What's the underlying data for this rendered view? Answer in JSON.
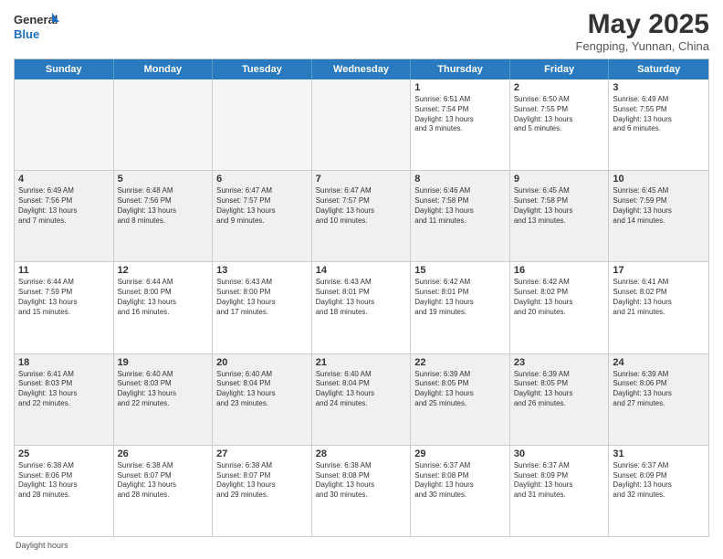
{
  "header": {
    "logo_general": "General",
    "logo_blue": "Blue",
    "title": "May 2025",
    "subtitle": "Fengping, Yunnan, China"
  },
  "calendar": {
    "days_of_week": [
      "Sunday",
      "Monday",
      "Tuesday",
      "Wednesday",
      "Thursday",
      "Friday",
      "Saturday"
    ],
    "weeks": [
      [
        {
          "day": "",
          "info": "",
          "empty": true
        },
        {
          "day": "",
          "info": "",
          "empty": true
        },
        {
          "day": "",
          "info": "",
          "empty": true
        },
        {
          "day": "",
          "info": "",
          "empty": true
        },
        {
          "day": "1",
          "info": "Sunrise: 6:51 AM\nSunset: 7:54 PM\nDaylight: 13 hours\nand 3 minutes."
        },
        {
          "day": "2",
          "info": "Sunrise: 6:50 AM\nSunset: 7:55 PM\nDaylight: 13 hours\nand 5 minutes."
        },
        {
          "day": "3",
          "info": "Sunrise: 6:49 AM\nSunset: 7:55 PM\nDaylight: 13 hours\nand 6 minutes."
        }
      ],
      [
        {
          "day": "4",
          "info": "Sunrise: 6:49 AM\nSunset: 7:56 PM\nDaylight: 13 hours\nand 7 minutes."
        },
        {
          "day": "5",
          "info": "Sunrise: 6:48 AM\nSunset: 7:56 PM\nDaylight: 13 hours\nand 8 minutes."
        },
        {
          "day": "6",
          "info": "Sunrise: 6:47 AM\nSunset: 7:57 PM\nDaylight: 13 hours\nand 9 minutes."
        },
        {
          "day": "7",
          "info": "Sunrise: 6:47 AM\nSunset: 7:57 PM\nDaylight: 13 hours\nand 10 minutes."
        },
        {
          "day": "8",
          "info": "Sunrise: 6:46 AM\nSunset: 7:58 PM\nDaylight: 13 hours\nand 11 minutes."
        },
        {
          "day": "9",
          "info": "Sunrise: 6:45 AM\nSunset: 7:58 PM\nDaylight: 13 hours\nand 13 minutes."
        },
        {
          "day": "10",
          "info": "Sunrise: 6:45 AM\nSunset: 7:59 PM\nDaylight: 13 hours\nand 14 minutes."
        }
      ],
      [
        {
          "day": "11",
          "info": "Sunrise: 6:44 AM\nSunset: 7:59 PM\nDaylight: 13 hours\nand 15 minutes."
        },
        {
          "day": "12",
          "info": "Sunrise: 6:44 AM\nSunset: 8:00 PM\nDaylight: 13 hours\nand 16 minutes."
        },
        {
          "day": "13",
          "info": "Sunrise: 6:43 AM\nSunset: 8:00 PM\nDaylight: 13 hours\nand 17 minutes."
        },
        {
          "day": "14",
          "info": "Sunrise: 6:43 AM\nSunset: 8:01 PM\nDaylight: 13 hours\nand 18 minutes."
        },
        {
          "day": "15",
          "info": "Sunrise: 6:42 AM\nSunset: 8:01 PM\nDaylight: 13 hours\nand 19 minutes."
        },
        {
          "day": "16",
          "info": "Sunrise: 6:42 AM\nSunset: 8:02 PM\nDaylight: 13 hours\nand 20 minutes."
        },
        {
          "day": "17",
          "info": "Sunrise: 6:41 AM\nSunset: 8:02 PM\nDaylight: 13 hours\nand 21 minutes."
        }
      ],
      [
        {
          "day": "18",
          "info": "Sunrise: 6:41 AM\nSunset: 8:03 PM\nDaylight: 13 hours\nand 22 minutes."
        },
        {
          "day": "19",
          "info": "Sunrise: 6:40 AM\nSunset: 8:03 PM\nDaylight: 13 hours\nand 22 minutes."
        },
        {
          "day": "20",
          "info": "Sunrise: 6:40 AM\nSunset: 8:04 PM\nDaylight: 13 hours\nand 23 minutes."
        },
        {
          "day": "21",
          "info": "Sunrise: 6:40 AM\nSunset: 8:04 PM\nDaylight: 13 hours\nand 24 minutes."
        },
        {
          "day": "22",
          "info": "Sunrise: 6:39 AM\nSunset: 8:05 PM\nDaylight: 13 hours\nand 25 minutes."
        },
        {
          "day": "23",
          "info": "Sunrise: 6:39 AM\nSunset: 8:05 PM\nDaylight: 13 hours\nand 26 minutes."
        },
        {
          "day": "24",
          "info": "Sunrise: 6:39 AM\nSunset: 8:06 PM\nDaylight: 13 hours\nand 27 minutes."
        }
      ],
      [
        {
          "day": "25",
          "info": "Sunrise: 6:38 AM\nSunset: 8:06 PM\nDaylight: 13 hours\nand 28 minutes."
        },
        {
          "day": "26",
          "info": "Sunrise: 6:38 AM\nSunset: 8:07 PM\nDaylight: 13 hours\nand 28 minutes."
        },
        {
          "day": "27",
          "info": "Sunrise: 6:38 AM\nSunset: 8:07 PM\nDaylight: 13 hours\nand 29 minutes."
        },
        {
          "day": "28",
          "info": "Sunrise: 6:38 AM\nSunset: 8:08 PM\nDaylight: 13 hours\nand 30 minutes."
        },
        {
          "day": "29",
          "info": "Sunrise: 6:37 AM\nSunset: 8:08 PM\nDaylight: 13 hours\nand 30 minutes."
        },
        {
          "day": "30",
          "info": "Sunrise: 6:37 AM\nSunset: 8:09 PM\nDaylight: 13 hours\nand 31 minutes."
        },
        {
          "day": "31",
          "info": "Sunrise: 6:37 AM\nSunset: 8:09 PM\nDaylight: 13 hours\nand 32 minutes."
        }
      ]
    ]
  },
  "footer": {
    "note": "Daylight hours"
  }
}
